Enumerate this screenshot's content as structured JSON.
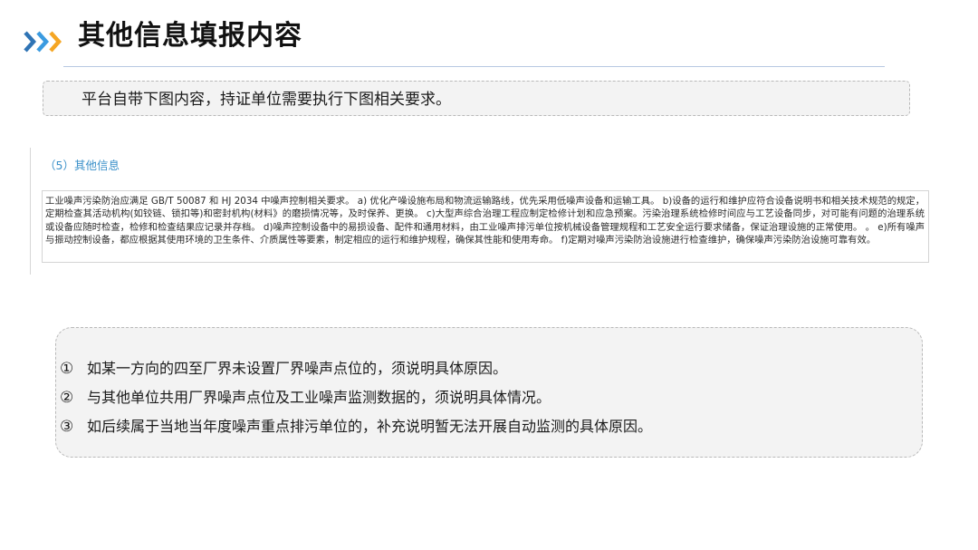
{
  "header": {
    "title": "其他信息填报内容",
    "chevron_colors": [
      "#2f74b5",
      "#3b9be0",
      "#f5a623"
    ]
  },
  "intro": {
    "text": "平台自带下图内容，持证单位需要执行下图相关要求。"
  },
  "form_screenshot": {
    "section_heading": "（5）其他信息",
    "accent_color": "#3a90c9",
    "content": "工业噪声污染防治应满足 GB/T 50087 和 HJ 2034 中噪声控制相关要求。 a) 优化产噪设施布局和物流运输路线，优先采用低噪声设备和运输工具。 b)设备的运行和维护应符合设备说明书和相关技术规范的规定，定期检查其活动机构(如铰链、锁扣等)和密封机构(材料》的磨损情况等，及时保养、更换。 c)大型声综合治理工程应制定检修计划和应急预案。污染治理系统检修时间应与工艺设备同步，对可能有问题的治理系统或设备应随时检查，检修和检查结果应记录并存档。 d)噪声控制设备中的易损设备、配件和通用材料，由工业噪声排污单位按机械设备管理规程和工艺安全运行要求储备，保证治理设施的正常使用。 。 e)所有噪声与振动控制设备，都应根据其使用环境的卫生条件、介质属性等要素，制定相应的运行和维护规程，确保其性能和使用寿命。 f)定期对噪声污染防治设施进行检查维护，确保噪声污染防治设施可靠有效。"
  },
  "notes": [
    {
      "marker": "①",
      "text": "如某一方向的四至厂界未设置厂界噪声点位的，须说明具体原因。"
    },
    {
      "marker": "②",
      "text": "与其他单位共用厂界噪声点位及工业噪声监测数据的，须说明具体情况。"
    },
    {
      "marker": "③",
      "text": "如后续属于当地当年度噪声重点排污单位的，补充说明暂无法开展自动监测的具体原因。"
    }
  ]
}
